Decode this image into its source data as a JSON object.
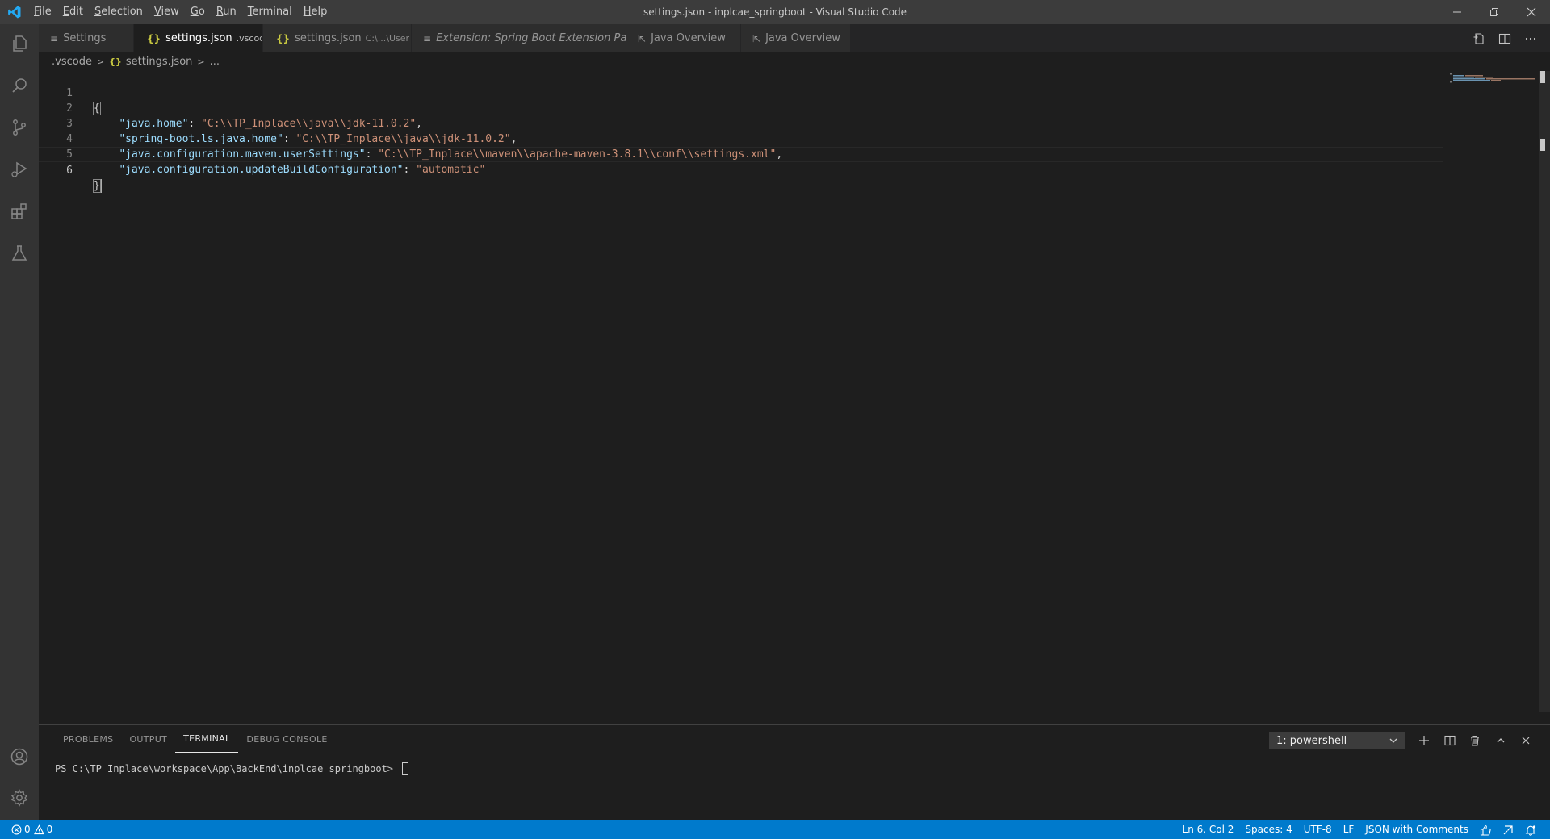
{
  "titlebar": {
    "title": "settings.json - inplcae_springboot - Visual Studio Code",
    "menu": [
      {
        "mn": "F",
        "rest": "ile"
      },
      {
        "mn": "E",
        "rest": "dit"
      },
      {
        "mn": "S",
        "rest": "election"
      },
      {
        "mn": "V",
        "rest": "iew"
      },
      {
        "mn": "G",
        "rest": "o"
      },
      {
        "mn": "R",
        "rest": "un"
      },
      {
        "mn": "T",
        "rest": "erminal"
      },
      {
        "mn": "H",
        "rest": "elp"
      }
    ]
  },
  "tabs": [
    {
      "icon": "≡",
      "label": "Settings",
      "desc": ""
    },
    {
      "icon": "{}",
      "label": "settings.json",
      "desc": ".vscode",
      "close": "✕"
    },
    {
      "icon": "{}",
      "label": "settings.json",
      "desc": "C:\\...\\User"
    },
    {
      "icon": "≡",
      "label": "Extension: Spring Boot Extension Pack",
      "desc": ""
    },
    {
      "icon": "⇱",
      "label": "Java Overview",
      "desc": ""
    },
    {
      "icon": "⇱",
      "label": "Java Overview",
      "desc": ""
    }
  ],
  "breadcrumb": {
    "folder": ".vscode",
    "file_icon": "{}",
    "file": "settings.json",
    "more": "..."
  },
  "editor": {
    "lines": [
      {
        "num": "1",
        "indent": "",
        "key": "",
        "sep": "",
        "val": "",
        "end": "",
        "brace": "{"
      },
      {
        "num": "2",
        "indent": "    ",
        "key": "\"java.home\"",
        "sep": ": ",
        "val": "\"C:\\\\TP_Inplace\\\\java\\\\jdk-11.0.2\"",
        "end": ","
      },
      {
        "num": "3",
        "indent": "    ",
        "key": "\"spring-boot.ls.java.home\"",
        "sep": ": ",
        "val": "\"C:\\\\TP_Inplace\\\\java\\\\jdk-11.0.2\"",
        "end": ","
      },
      {
        "num": "4",
        "indent": "    ",
        "key": "\"java.configuration.maven.userSettings\"",
        "sep": ": ",
        "val": "\"C:\\\\TP_Inplace\\\\maven\\\\apache-maven-3.8.1\\\\conf\\\\settings.xml\"",
        "end": ","
      },
      {
        "num": "5",
        "indent": "    ",
        "key": "\"java.configuration.updateBuildConfiguration\"",
        "sep": ": ",
        "val": "\"automatic\"",
        "end": ""
      },
      {
        "num": "6",
        "indent": "",
        "key": "",
        "sep": "",
        "val": "",
        "end": "",
        "brace": "}"
      }
    ]
  },
  "panel": {
    "tabs": [
      "PROBLEMS",
      "OUTPUT",
      "TERMINAL",
      "DEBUG CONSOLE"
    ],
    "active_tab": "TERMINAL",
    "terminal_select": "1: powershell",
    "terminal_prompt": "PS C:\\TP_Inplace\\workspace\\App\\BackEnd\\inplcae_springboot> "
  },
  "statusbar": {
    "errors": "0",
    "warnings": "0",
    "position": "Ln 6, Col 2",
    "spaces": "Spaces: 4",
    "encoding": "UTF-8",
    "eol": "LF",
    "language": "JSON with Comments"
  },
  "colors": {
    "accent": "#007acc",
    "json_key": "#9cdcfe",
    "json_string": "#ce9178"
  }
}
